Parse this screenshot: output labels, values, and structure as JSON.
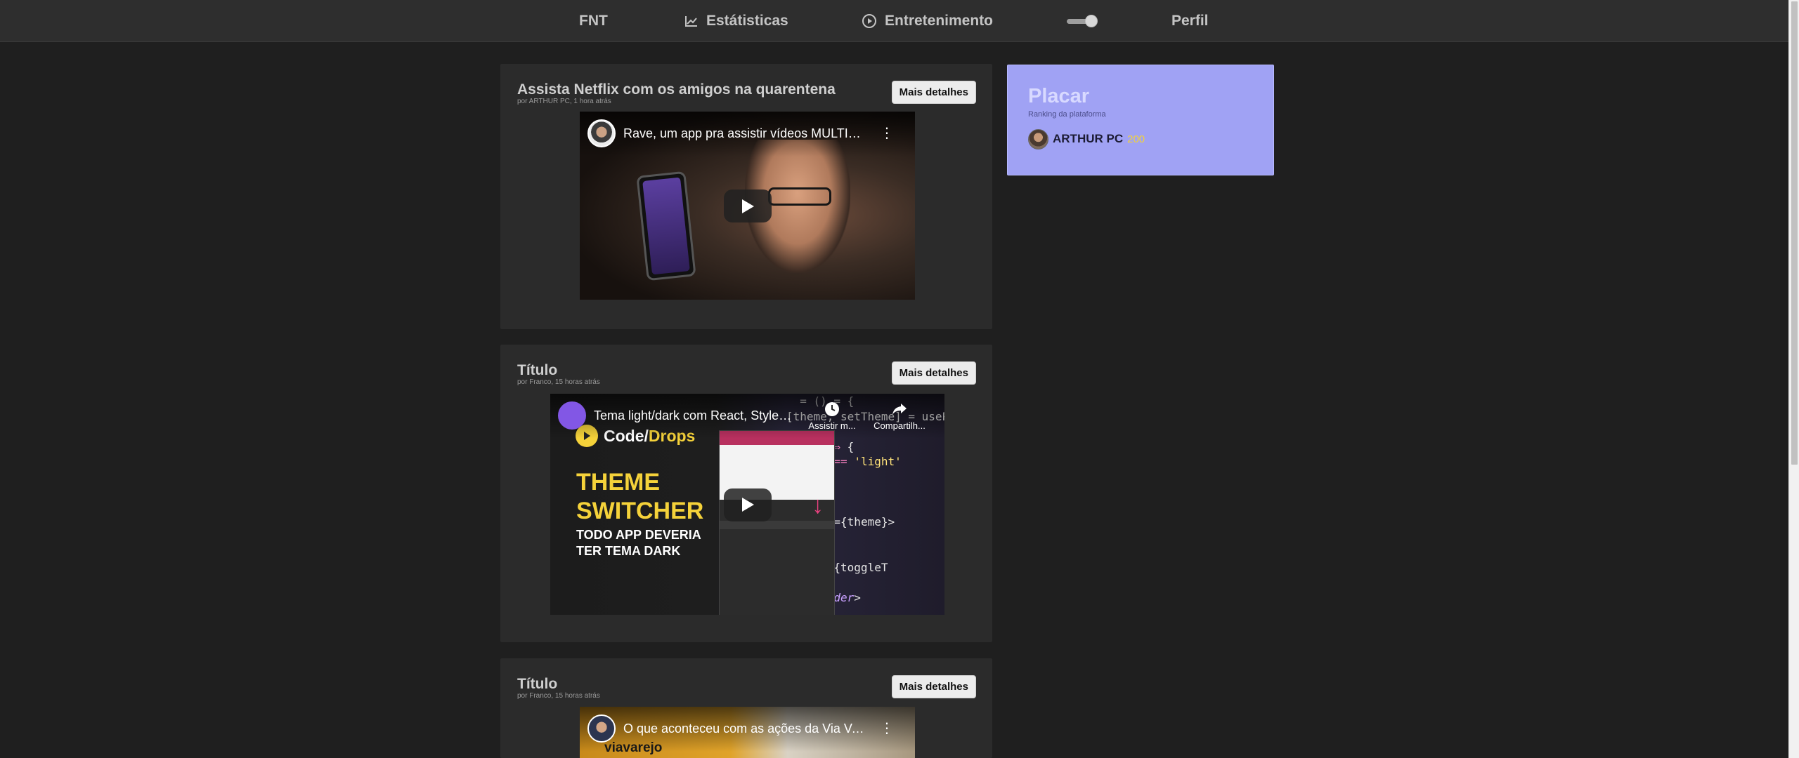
{
  "nav": {
    "brand": "FNT",
    "stats": "Estátisticas",
    "entertainment": "Entretenimento",
    "profile": "Perfil",
    "theme_toggle_on": true
  },
  "posts": [
    {
      "title": "Assista Netflix com os amigos na quarentena",
      "meta": "por ARTHUR PC, 1 hora atrás",
      "button": "Mais detalhes",
      "video_title": "Rave, um app pra assistir vídeos MULTIPLAYER",
      "video_kebab": "⋮"
    },
    {
      "title": "Título",
      "meta": "por Franco, 15 horas atrás",
      "button": "Mais detalhes",
      "video_title": "Tema light/dark com React, Styled-components",
      "watch_later": "Assistir m...",
      "share": "Compartilh...",
      "thumb_brand_a": "Code/",
      "thumb_brand_b": "Drops",
      "thumb_heading_1": "THEME",
      "thumb_heading_2": "SWITCHER",
      "thumb_sub_1": "TODO APP DEVERIA",
      "thumb_sub_2": "TER TEMA DARK"
    },
    {
      "title": "Título",
      "meta": "por Franco, 15 horas atrás",
      "button": "Mais detalhes",
      "video_title": "O que aconteceu com as ações da Via Varejo",
      "video_kebab": "⋮",
      "thumb_brand": "viavarejo"
    }
  ],
  "scoreboard": {
    "title": "Placar",
    "subtitle": "Ranking da plataforma",
    "entries": [
      {
        "name": "ARTHUR PC",
        "score": "200"
      }
    ]
  },
  "colors": {
    "background": "#1f1f1f",
    "navbar": "#2e2e2e",
    "card": "#2b2b2b",
    "scoreboard": "#a0a2f4",
    "score": "#f2d23a"
  }
}
